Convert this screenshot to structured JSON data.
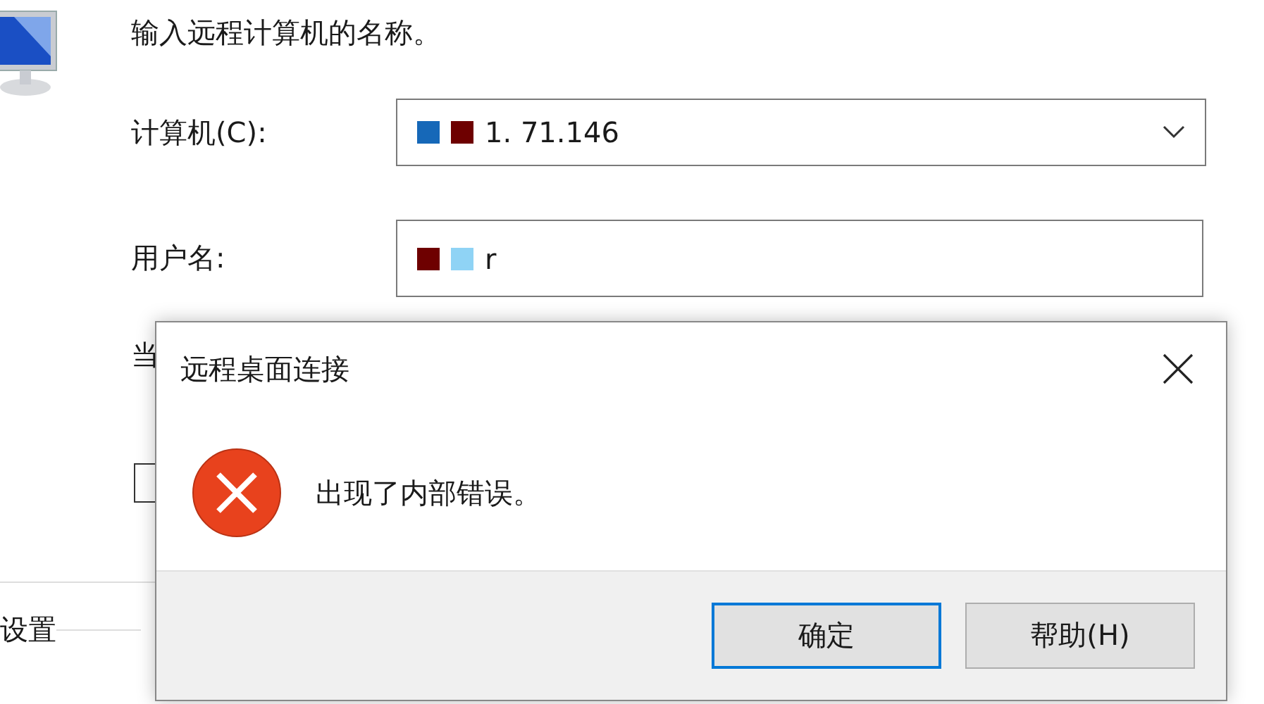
{
  "main_window": {
    "instruction": "输入远程计算机的名称。",
    "computer": {
      "label": "计算机(C):",
      "value": "1.  71.146",
      "redactions": [
        {
          "color": "#1668b8"
        },
        {
          "color": "#6e0000"
        }
      ]
    },
    "username": {
      "label": "用户名:",
      "value": "r",
      "redactions": [
        {
          "color": "#6e0000"
        },
        {
          "color": "#8fd3f5"
        }
      ]
    },
    "partial_text": "当",
    "checkbox": {
      "checked": false
    },
    "section": "设置"
  },
  "error_dialog": {
    "title": "远程桌面连接",
    "message": "出现了内部错误。",
    "buttons": [
      {
        "label": "确定",
        "default": true
      },
      {
        "label": "帮助(H)",
        "default": false
      }
    ]
  }
}
